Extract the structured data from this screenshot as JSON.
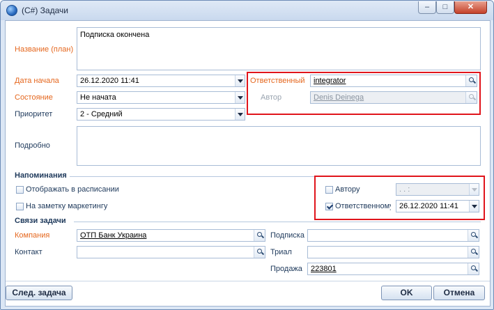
{
  "window": {
    "title": "(C#) Задачи"
  },
  "titlebar_buttons": {
    "minimize": "–",
    "maximize": "□",
    "close": "✕"
  },
  "form": {
    "name_label": "Название (план)",
    "name_value": "Подписка окончена",
    "start_date_label": "Дата начала",
    "start_date_value": "26.12.2020 11:41",
    "state_label": "Состояние",
    "state_value": "Не начата",
    "priority_label": "Приоритет",
    "priority_value": "2 - Средний",
    "details_label": "Подробно",
    "details_value": "",
    "responsible_label": "Ответственный",
    "responsible_value": "integrator",
    "author_label": "Автор",
    "author_value": "Denis Deinega"
  },
  "reminders": {
    "title": "Напоминания",
    "show_in_schedule_label": "Отображать в расписании",
    "show_in_schedule_checked": false,
    "marketing_note_label": "На заметку маркетингу",
    "marketing_note_checked": false,
    "to_author_label": "Автору",
    "to_author_checked": false,
    "to_author_value": ". .  :",
    "to_responsible_label": "Ответственному",
    "to_responsible_checked": true,
    "to_responsible_value": "26.12.2020 11:41"
  },
  "links": {
    "title": "Связи задачи",
    "company_label": "Компания",
    "company_value": "ОТП Банк Украина",
    "contact_label": "Контакт",
    "contact_value": "",
    "subscription_label": "Подписка",
    "subscription_value": "",
    "trial_label": "Триал",
    "trial_value": "",
    "sale_label": "Продажа",
    "sale_value": "223801"
  },
  "buttons": {
    "next_task": "След. задача",
    "ok": "OK",
    "cancel": "Отмена"
  },
  "colors": {
    "required_label": "#e5671e",
    "label": "#1e395b",
    "highlight_box": "#e0141b"
  }
}
